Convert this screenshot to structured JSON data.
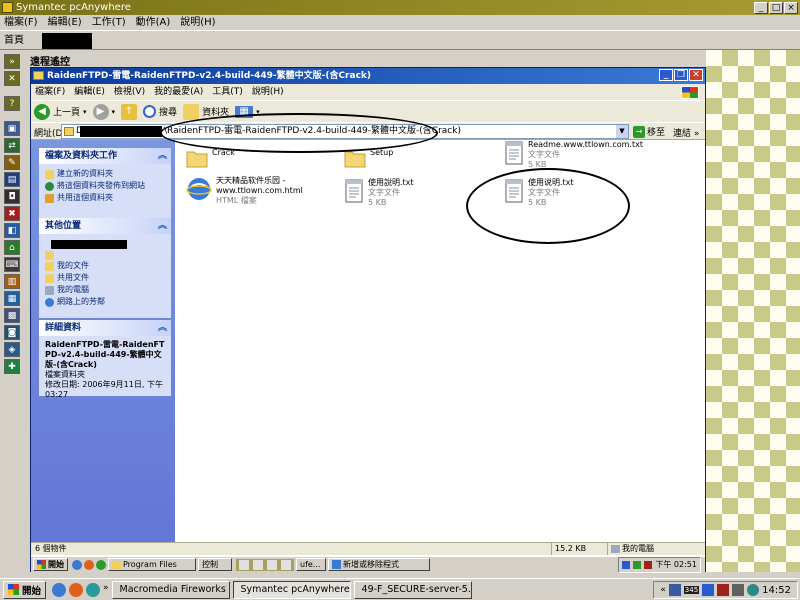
{
  "outer": {
    "title": "Symantec pcAnywhere",
    "menu": [
      "檔案(F)",
      "編輯(E)",
      "工作(T)",
      "動作(A)",
      "說明(H)"
    ],
    "home_tab": "首頁",
    "session_label": "遠程遙控",
    "caption_buttons": [
      "_",
      "□",
      "×"
    ]
  },
  "inner": {
    "title": "RaidenFTPD-雷電-RaidenFTPD-v2.4-build-449-繁體中文版-(含Crack)",
    "menu": [
      "檔案(F)",
      "編輯(E)",
      "檢視(V)",
      "我的最愛(A)",
      "工具(T)",
      "說明(H)"
    ],
    "toolbar": {
      "back": "上一頁",
      "search": "搜尋",
      "folders": "資料夾"
    },
    "address": {
      "label": "網址(D)",
      "drive": "D",
      "path": "\\RaidenFTPD-雷電-RaidenFTPD-v2.4-build-449-繁體中文版-(含Crack)",
      "go": "移至",
      "links": "連結"
    },
    "tasks": {
      "title": "檔案及資料夾工作",
      "items": [
        "建立新的資料夾",
        "將這個資料夾發佈到網站",
        "共用這個資料夾"
      ]
    },
    "places": {
      "title": "其他位置",
      "items": [
        "我的文件",
        "共用文件",
        "我的電腦",
        "網路上的芳鄰"
      ]
    },
    "details": {
      "title": "詳細資料",
      "name": "RaidenFTPD-雷電-RaidenFTPD-v2.4-build-449-繁體中文版-(含Crack)",
      "type": "檔案資料夾",
      "modified": "修改日期: 2006年9月11日, 下午 03:27"
    },
    "files": [
      {
        "name": "Crack",
        "sub1": "",
        "sub2": "",
        "icon": "folder-icon"
      },
      {
        "name": "Setup",
        "sub1": "",
        "sub2": "",
        "icon": "folder-icon"
      },
      {
        "name": "Readme.www.ttlown.com.txt",
        "sub1": "文字文件",
        "sub2": "5 KB",
        "icon": "text-file-icon"
      },
      {
        "name": "天天精品软件乐园 -www.ttlown.com.html",
        "sub1": "HTML 檔案",
        "sub2": "",
        "icon": "html-file-icon"
      },
      {
        "name": "使用說明.txt",
        "sub1": "文字文件",
        "sub2": "5 KB",
        "icon": "text-file-icon"
      },
      {
        "name": "使用说明.txt",
        "sub1": "文字文件",
        "sub2": "5 KB",
        "icon": "text-file-icon"
      }
    ],
    "status": {
      "count": "6 個物件",
      "size": "15.2 KB",
      "location": "我的電腦"
    },
    "remote_taskbar": {
      "start": "開始",
      "items": [
        "Program Files",
        "控制",
        "ufe...",
        "新增或移除程式"
      ],
      "clock": "下午 02:51"
    }
  },
  "taskbar": {
    "start": "開始",
    "items": [
      "Macromedia Fireworks M...",
      "Symantec pcAnywhere",
      "49-F_SECURE-server-5.5..."
    ],
    "clock": "14:52",
    "tray_badge": "345"
  },
  "colors": {
    "outer_title": "#8a8020",
    "inner_title": "#0a3a9a",
    "taskpane": "#7a96df"
  }
}
